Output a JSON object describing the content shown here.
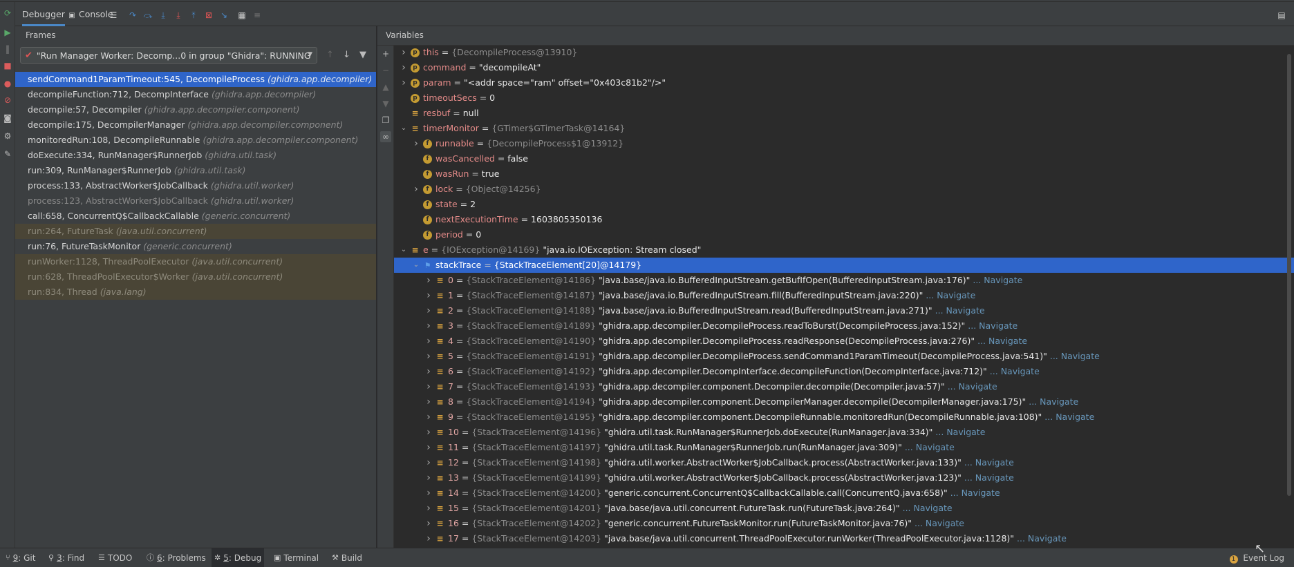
{
  "header": {
    "tabs": [
      {
        "label": "Debugger"
      },
      {
        "label": "Console"
      }
    ]
  },
  "frames": {
    "title": "Frames",
    "thread": "\"Run Manager Worker: Decomp...0 in group \"Ghidra\": RUNNING",
    "items": [
      {
        "method": "sendCommand1ParamTimeout:545, DecompileProcess",
        "pkg": "(ghidra.app.decompiler)",
        "kind": "sel"
      },
      {
        "method": "decompileFunction:712, DecompInterface",
        "pkg": "(ghidra.app.decompiler)",
        "kind": "normal"
      },
      {
        "method": "decompile:57, Decompiler",
        "pkg": "(ghidra.app.decompiler.component)",
        "kind": "normal"
      },
      {
        "method": "decompile:175, DecompilerManager",
        "pkg": "(ghidra.app.decompiler.component)",
        "kind": "normal"
      },
      {
        "method": "monitoredRun:108, DecompileRunnable",
        "pkg": "(ghidra.app.decompiler.component)",
        "kind": "normal"
      },
      {
        "method": "doExecute:334, RunManager$RunnerJob",
        "pkg": "(ghidra.util.task)",
        "kind": "normal"
      },
      {
        "method": "run:309, RunManager$RunnerJob",
        "pkg": "(ghidra.util.task)",
        "kind": "normal"
      },
      {
        "method": "process:133, AbstractWorker$JobCallback",
        "pkg": "(ghidra.util.worker)",
        "kind": "normal"
      },
      {
        "method": "process:123, AbstractWorker$JobCallback",
        "pkg": "(ghidra.util.worker)",
        "kind": "dim"
      },
      {
        "method": "call:658, ConcurrentQ$CallbackCallable",
        "pkg": "(generic.concurrent)",
        "kind": "normal"
      },
      {
        "method": "run:264, FutureTask",
        "pkg": "(java.util.concurrent)",
        "kind": "lib"
      },
      {
        "method": "run:76, FutureTaskMonitor",
        "pkg": "(generic.concurrent)",
        "kind": "normal"
      },
      {
        "method": "runWorker:1128, ThreadPoolExecutor",
        "pkg": "(java.util.concurrent)",
        "kind": "lib"
      },
      {
        "method": "run:628, ThreadPoolExecutor$Worker",
        "pkg": "(java.util.concurrent)",
        "kind": "lib"
      },
      {
        "method": "run:834, Thread",
        "pkg": "(java.lang)",
        "kind": "lib"
      }
    ]
  },
  "variables": {
    "title": "Variables",
    "rows": [
      {
        "level": 0,
        "expand": "right",
        "icon": "p",
        "name": "this",
        "ref": "{DecompileProcess@13910}",
        "value": ""
      },
      {
        "level": 0,
        "expand": "right",
        "icon": "p",
        "name": "command",
        "ref": "",
        "value": "\"decompileAt\""
      },
      {
        "level": 0,
        "expand": "right",
        "icon": "p",
        "name": "param",
        "ref": "",
        "value": "\"<addr space=\"ram\" offset=\"0x403c81b2\"/>\""
      },
      {
        "level": 0,
        "expand": "",
        "icon": "p",
        "name": "timeoutSecs",
        "ref": "",
        "value": "0"
      },
      {
        "level": 0,
        "expand": "",
        "icon": "eq",
        "name": "resbuf",
        "ref": "",
        "value": "null"
      },
      {
        "level": 0,
        "expand": "down",
        "icon": "eq",
        "name": "timerMonitor",
        "ref": "{GTimer$GTimerTask@14164}",
        "value": ""
      },
      {
        "level": 1,
        "expand": "right",
        "icon": "f",
        "name": "runnable",
        "ref": "{DecompileProcess$1@13912}",
        "value": ""
      },
      {
        "level": 1,
        "expand": "",
        "icon": "f",
        "name": "wasCancelled",
        "ref": "",
        "value": "false"
      },
      {
        "level": 1,
        "expand": "",
        "icon": "f",
        "name": "wasRun",
        "ref": "",
        "value": "true"
      },
      {
        "level": 1,
        "expand": "right",
        "icon": "f",
        "name": "lock",
        "ref": "{Object@14256}",
        "value": ""
      },
      {
        "level": 1,
        "expand": "",
        "icon": "f",
        "name": "state",
        "ref": "",
        "value": "2"
      },
      {
        "level": 1,
        "expand": "",
        "icon": "f",
        "name": "nextExecutionTime",
        "ref": "",
        "value": "1603805350136"
      },
      {
        "level": 1,
        "expand": "",
        "icon": "f",
        "name": "period",
        "ref": "",
        "value": "0"
      },
      {
        "level": 0,
        "expand": "down",
        "icon": "eq",
        "name": "e",
        "ref": "{IOException@14169}",
        "value": "\"java.io.IOException: Stream closed\""
      },
      {
        "level": 1,
        "expand": "down",
        "icon": "flag",
        "name": "stackTrace",
        "ref": "{StackTraceElement[20]@14179}",
        "value": "",
        "selected": true
      },
      {
        "level": 2,
        "expand": "right",
        "icon": "eq",
        "name": "0",
        "ref": "{StackTraceElement@14186}",
        "value": "\"java.base/java.io.BufferedInputStream.getBufIfOpen(BufferedInputStream.java:176)\"",
        "nav": "... Navigate"
      },
      {
        "level": 2,
        "expand": "right",
        "icon": "eq",
        "name": "1",
        "ref": "{StackTraceElement@14187}",
        "value": "\"java.base/java.io.BufferedInputStream.fill(BufferedInputStream.java:220)\"",
        "nav": "... Navigate"
      },
      {
        "level": 2,
        "expand": "right",
        "icon": "eq",
        "name": "2",
        "ref": "{StackTraceElement@14188}",
        "value": "\"java.base/java.io.BufferedInputStream.read(BufferedInputStream.java:271)\"",
        "nav": "... Navigate"
      },
      {
        "level": 2,
        "expand": "right",
        "icon": "eq",
        "name": "3",
        "ref": "{StackTraceElement@14189}",
        "value": "\"ghidra.app.decompiler.DecompileProcess.readToBurst(DecompileProcess.java:152)\"",
        "nav": "... Navigate"
      },
      {
        "level": 2,
        "expand": "right",
        "icon": "eq",
        "name": "4",
        "ref": "{StackTraceElement@14190}",
        "value": "\"ghidra.app.decompiler.DecompileProcess.readResponse(DecompileProcess.java:276)\"",
        "nav": "... Navigate"
      },
      {
        "level": 2,
        "expand": "right",
        "icon": "eq",
        "name": "5",
        "ref": "{StackTraceElement@14191}",
        "value": "\"ghidra.app.decompiler.DecompileProcess.sendCommand1ParamTimeout(DecompileProcess.java:541)\"",
        "nav": "... Navigate"
      },
      {
        "level": 2,
        "expand": "right",
        "icon": "eq",
        "name": "6",
        "ref": "{StackTraceElement@14192}",
        "value": "\"ghidra.app.decompiler.DecompInterface.decompileFunction(DecompInterface.java:712)\"",
        "nav": "... Navigate"
      },
      {
        "level": 2,
        "expand": "right",
        "icon": "eq",
        "name": "7",
        "ref": "{StackTraceElement@14193}",
        "value": "\"ghidra.app.decompiler.component.Decompiler.decompile(Decompiler.java:57)\"",
        "nav": "... Navigate"
      },
      {
        "level": 2,
        "expand": "right",
        "icon": "eq",
        "name": "8",
        "ref": "{StackTraceElement@14194}",
        "value": "\"ghidra.app.decompiler.component.DecompilerManager.decompile(DecompilerManager.java:175)\"",
        "nav": "... Navigate"
      },
      {
        "level": 2,
        "expand": "right",
        "icon": "eq",
        "name": "9",
        "ref": "{StackTraceElement@14195}",
        "value": "\"ghidra.app.decompiler.component.DecompileRunnable.monitoredRun(DecompileRunnable.java:108)\"",
        "nav": "... Navigate"
      },
      {
        "level": 2,
        "expand": "right",
        "icon": "eq",
        "name": "10",
        "ref": "{StackTraceElement@14196}",
        "value": "\"ghidra.util.task.RunManager$RunnerJob.doExecute(RunManager.java:334)\"",
        "nav": "... Navigate"
      },
      {
        "level": 2,
        "expand": "right",
        "icon": "eq",
        "name": "11",
        "ref": "{StackTraceElement@14197}",
        "value": "\"ghidra.util.task.RunManager$RunnerJob.run(RunManager.java:309)\"",
        "nav": "... Navigate"
      },
      {
        "level": 2,
        "expand": "right",
        "icon": "eq",
        "name": "12",
        "ref": "{StackTraceElement@14198}",
        "value": "\"ghidra.util.worker.AbstractWorker$JobCallback.process(AbstractWorker.java:133)\"",
        "nav": "... Navigate"
      },
      {
        "level": 2,
        "expand": "right",
        "icon": "eq",
        "name": "13",
        "ref": "{StackTraceElement@14199}",
        "value": "\"ghidra.util.worker.AbstractWorker$JobCallback.process(AbstractWorker.java:123)\"",
        "nav": "... Navigate"
      },
      {
        "level": 2,
        "expand": "right",
        "icon": "eq",
        "name": "14",
        "ref": "{StackTraceElement@14200}",
        "value": "\"generic.concurrent.ConcurrentQ$CallbackCallable.call(ConcurrentQ.java:658)\"",
        "nav": "... Navigate"
      },
      {
        "level": 2,
        "expand": "right",
        "icon": "eq",
        "name": "15",
        "ref": "{StackTraceElement@14201}",
        "value": "\"java.base/java.util.concurrent.FutureTask.run(FutureTask.java:264)\"",
        "nav": "... Navigate"
      },
      {
        "level": 2,
        "expand": "right",
        "icon": "eq",
        "name": "16",
        "ref": "{StackTraceElement@14202}",
        "value": "\"generic.concurrent.FutureTaskMonitor.run(FutureTaskMonitor.java:76)\"",
        "nav": "... Navigate"
      },
      {
        "level": 2,
        "expand": "right",
        "icon": "eq",
        "name": "17",
        "ref": "{StackTraceElement@14203}",
        "value": "\"java.base/java.util.concurrent.ThreadPoolExecutor.runWorker(ThreadPoolExecutor.java:1128)\"",
        "nav": "... Navigate"
      }
    ]
  },
  "statusbar": {
    "items": [
      {
        "key": "9",
        "label": ": Git",
        "icon": "⑂"
      },
      {
        "key": "3",
        "label": ": Find",
        "icon": "⚲"
      },
      {
        "key": "",
        "label": "TODO",
        "icon": "☰"
      },
      {
        "key": "6",
        "label": ": Problems",
        "icon": "ⓘ"
      },
      {
        "key": "5",
        "label": ": Debug",
        "icon": "✲",
        "active": true
      },
      {
        "key": "",
        "label": "Terminal",
        "icon": "▣"
      },
      {
        "key": "",
        "label": "Build",
        "icon": "⚒"
      }
    ],
    "event_log": "Event Log",
    "event_log_badge": "1"
  },
  "colors": {
    "selection": "#2f65ca",
    "library_frame": "#4a4536",
    "variable_name": "#e38a88",
    "navigate_link": "#6897bb"
  }
}
